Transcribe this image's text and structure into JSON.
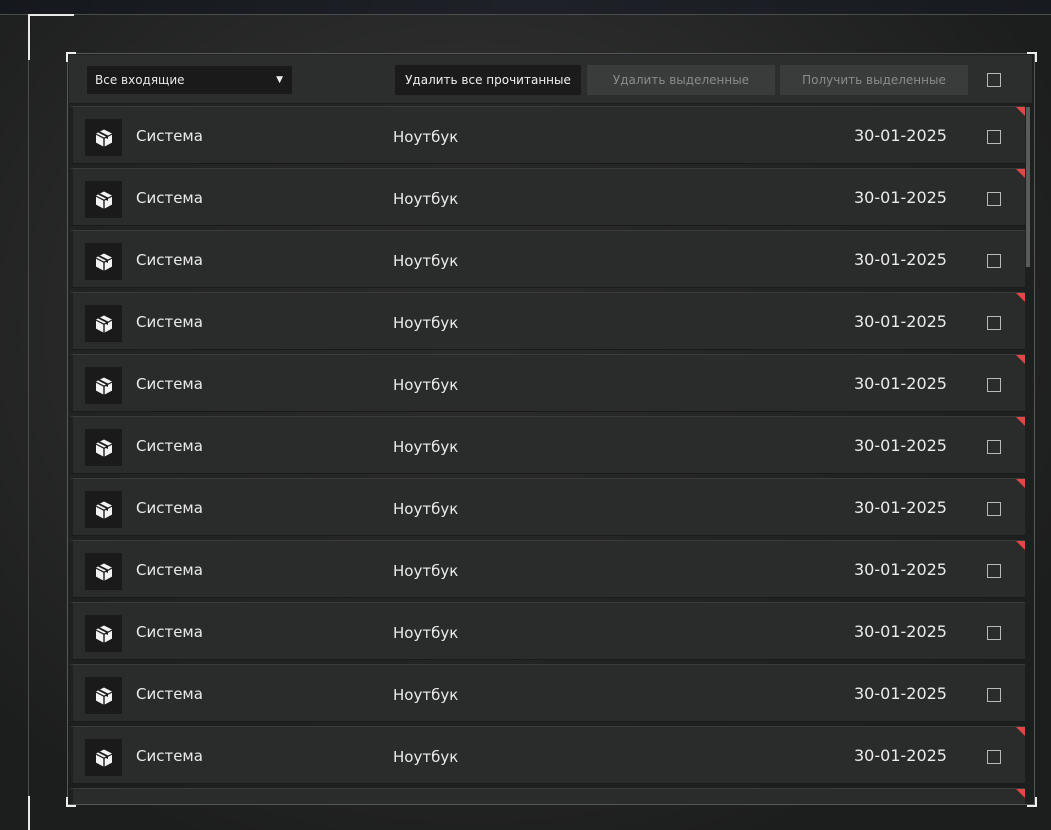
{
  "toolbar": {
    "filter_value": "Все входящие",
    "delete_read_label": "Удалить все прочитанные",
    "delete_selected_label": "Удалить выделенные",
    "receive_selected_label": "Получить выделенные"
  },
  "colors": {
    "unread_marker": "#e04848",
    "row_background": "#2a2b2b",
    "active_button": "#1b1b1b",
    "disabled_button": "#3a3b3b"
  },
  "messages": [
    {
      "sender": "Система",
      "subject": "Ноутбук",
      "date": "30-01-2025",
      "unread": true,
      "icon": "package-icon"
    },
    {
      "sender": "Система",
      "subject": "Ноутбук",
      "date": "30-01-2025",
      "unread": true,
      "icon": "package-icon"
    },
    {
      "sender": "Система",
      "subject": "Ноутбук",
      "date": "30-01-2025",
      "unread": false,
      "icon": "package-icon"
    },
    {
      "sender": "Система",
      "subject": "Ноутбук",
      "date": "30-01-2025",
      "unread": true,
      "icon": "package-icon"
    },
    {
      "sender": "Система",
      "subject": "Ноутбук",
      "date": "30-01-2025",
      "unread": true,
      "icon": "package-icon"
    },
    {
      "sender": "Система",
      "subject": "Ноутбук",
      "date": "30-01-2025",
      "unread": true,
      "icon": "package-icon"
    },
    {
      "sender": "Система",
      "subject": "Ноутбук",
      "date": "30-01-2025",
      "unread": true,
      "icon": "package-icon"
    },
    {
      "sender": "Система",
      "subject": "Ноутбук",
      "date": "30-01-2025",
      "unread": true,
      "icon": "package-icon"
    },
    {
      "sender": "Система",
      "subject": "Ноутбук",
      "date": "30-01-2025",
      "unread": false,
      "icon": "package-icon"
    },
    {
      "sender": "Система",
      "subject": "Ноутбук",
      "date": "30-01-2025",
      "unread": false,
      "icon": "package-icon"
    },
    {
      "sender": "Система",
      "subject": "Ноутбук",
      "date": "30-01-2025",
      "unread": true,
      "icon": "package-icon"
    },
    {
      "sender": "",
      "subject": "",
      "date": "",
      "unread": true,
      "icon": ""
    }
  ]
}
